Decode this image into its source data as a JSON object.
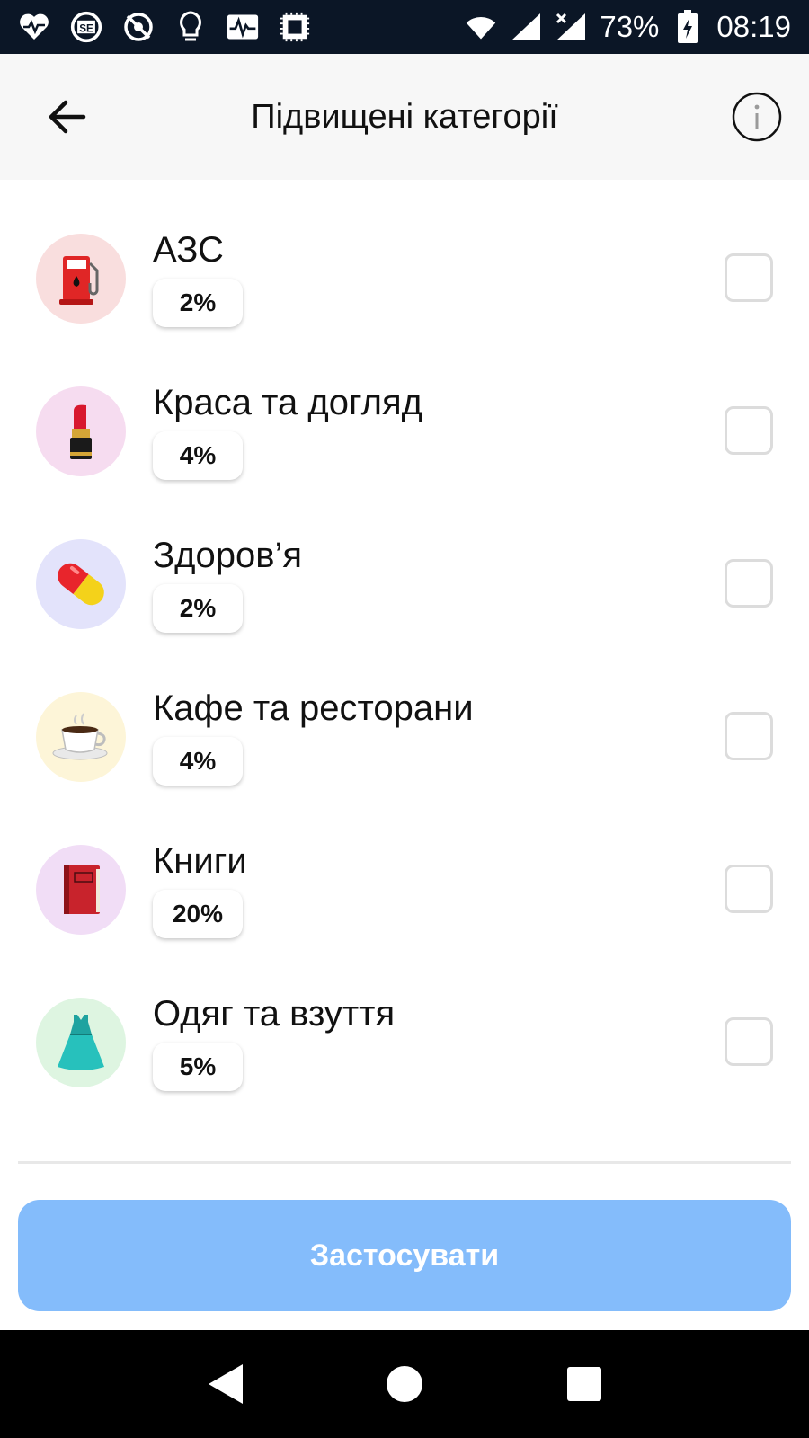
{
  "status_bar": {
    "battery_percent": "73%",
    "time": "08:19",
    "left_icons": [
      "heart-rate-icon",
      "se-app-icon",
      "no-location-icon",
      "lightbulb-icon",
      "pulse-monitor-icon",
      "chip-icon"
    ],
    "right_icons": [
      "wifi-icon",
      "signal-icon",
      "signal-x-icon",
      "battery-charging-icon"
    ]
  },
  "header": {
    "title": "Підвищені категорії",
    "back_icon": "arrow-left-icon",
    "info_icon": "info-icon"
  },
  "categories": [
    {
      "name": "АЗС",
      "rate": "2%",
      "icon": "fuel-pump-icon",
      "icon_bg": "#f9dede",
      "checked": false
    },
    {
      "name": "Краса та догляд",
      "rate": "4%",
      "icon": "lipstick-icon",
      "icon_bg": "#f6dcf0",
      "checked": false
    },
    {
      "name": "Здоров’я",
      "rate": "2%",
      "icon": "pill-icon",
      "icon_bg": "#e3e3fb",
      "checked": false
    },
    {
      "name": "Кафе та ресторани",
      "rate": "4%",
      "icon": "coffee-cup-icon",
      "icon_bg": "#fdf5d8",
      "checked": false
    },
    {
      "name": "Книги",
      "rate": "20%",
      "icon": "book-icon",
      "icon_bg": "#f1ddf6",
      "checked": false
    },
    {
      "name": "Одяг та взуття",
      "rate": "5%",
      "icon": "dress-icon",
      "icon_bg": "#def5e1",
      "checked": false
    }
  ],
  "apply_button": {
    "label": "Застосувати",
    "color": "#84bcfb"
  },
  "nav_bar": {
    "icons": [
      "nav-back-icon",
      "nav-home-icon",
      "nav-recents-icon"
    ]
  }
}
